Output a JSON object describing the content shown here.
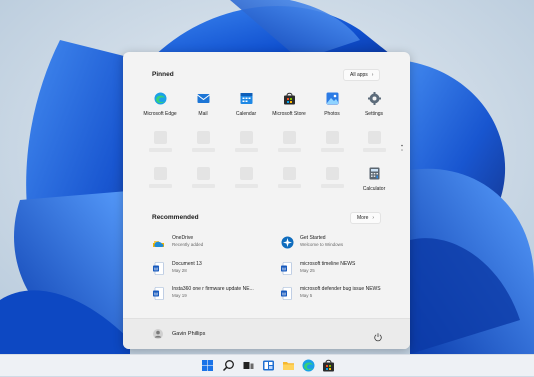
{
  "start_menu": {
    "pinned": {
      "title": "Pinned",
      "all_apps_label": "All apps",
      "apps": [
        {
          "label": "Microsoft Edge",
          "icon": "edge-icon"
        },
        {
          "label": "Mail",
          "icon": "mail-icon"
        },
        {
          "label": "Calendar",
          "icon": "calendar-icon"
        },
        {
          "label": "Microsoft Store",
          "icon": "store-icon"
        },
        {
          "label": "Photos",
          "icon": "photos-icon"
        },
        {
          "label": "Settings",
          "icon": "gear-icon"
        },
        {
          "label": "Calculator",
          "icon": "calculator-icon"
        }
      ]
    },
    "recommended": {
      "title": "Recommended",
      "more_label": "More",
      "items": [
        {
          "name": "OneDrive",
          "detail": "Recently added",
          "icon": "onedrive-icon"
        },
        {
          "name": "Get Started",
          "detail": "Welcome to Windows",
          "icon": "get-started-icon"
        },
        {
          "name": "Document 13",
          "detail": "May 28",
          "icon": "word-doc-icon"
        },
        {
          "name": "microsoft timeline NEWS",
          "detail": "May 25",
          "icon": "word-doc-icon"
        },
        {
          "name": "Insta360 one r firmware update NE...",
          "detail": "May 19",
          "icon": "word-doc-icon"
        },
        {
          "name": "microsoft defender bug issue NEWS",
          "detail": "May 5",
          "icon": "word-doc-icon"
        }
      ]
    },
    "user": {
      "name": "Gavin Phillips"
    }
  },
  "taskbar": {
    "icons": [
      "windows-start-icon",
      "search-icon",
      "task-view-icon",
      "widgets-icon",
      "file-explorer-icon",
      "edge-icon",
      "store-icon"
    ]
  },
  "colors": {
    "accent": "#0078d4",
    "wallpaper_blue": "#1a5fd6",
    "menu_bg": "#f3f3f3"
  }
}
